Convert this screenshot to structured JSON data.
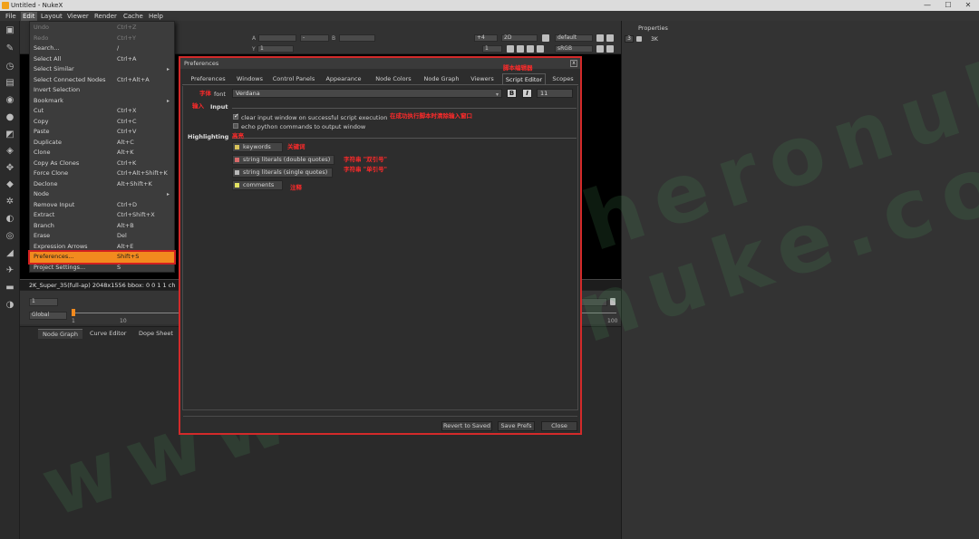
{
  "window": {
    "title": "Untitled - NukeX",
    "minimize": "—",
    "maximize": "☐",
    "close": "✕"
  },
  "menubar": [
    "File",
    "Edit",
    "Layout",
    "Viewer",
    "Render",
    "Cache",
    "Help"
  ],
  "edit_menu": [
    {
      "label": "Undo",
      "shortcut": "Ctrl+Z",
      "disabled": true
    },
    {
      "label": "Redo",
      "shortcut": "Ctrl+Y",
      "disabled": true
    },
    {
      "label": "Search...",
      "shortcut": "/"
    },
    {
      "label": "Select All",
      "shortcut": "Ctrl+A"
    },
    {
      "label": "Select Similar",
      "submenu": true
    },
    {
      "label": "Select Connected Nodes",
      "shortcut": "Ctrl+Alt+A"
    },
    {
      "label": "Invert Selection",
      "shortcut": ""
    },
    {
      "label": "Bookmark",
      "submenu": true
    },
    {
      "label": "Cut",
      "shortcut": "Ctrl+X"
    },
    {
      "label": "Copy",
      "shortcut": "Ctrl+C"
    },
    {
      "label": "Paste",
      "shortcut": "Ctrl+V"
    },
    {
      "label": "Duplicate",
      "shortcut": "Alt+C"
    },
    {
      "label": "Clone",
      "shortcut": "Alt+K"
    },
    {
      "label": "Copy As Clones",
      "shortcut": "Ctrl+K"
    },
    {
      "label": "Force Clone",
      "shortcut": "Ctrl+Alt+Shift+K"
    },
    {
      "label": "Declone",
      "shortcut": "Alt+Shift+K"
    },
    {
      "label": "Node",
      "submenu": true
    },
    {
      "label": "Remove Input",
      "shortcut": "Ctrl+D"
    },
    {
      "label": "Extract",
      "shortcut": "Ctrl+Shift+X"
    },
    {
      "label": "Branch",
      "shortcut": "Alt+B"
    },
    {
      "label": "Erase",
      "shortcut": "Del"
    },
    {
      "label": "Expression Arrows",
      "shortcut": "Alt+E"
    },
    {
      "label": "Preferences...",
      "shortcut": "Shift+S",
      "highlight": true
    },
    {
      "label": "Project Settings...",
      "shortcut": "S"
    }
  ],
  "viewer": {
    "channel_a": "A",
    "channel_b": "B",
    "gain": "+4",
    "view_mode": "2D",
    "lut": "default",
    "colorspace": "sRGB",
    "frame_step": "1",
    "y_label": "Y",
    "y_value": "1",
    "status": "2K_Super_35(full-ap) 2048x1556 bbox: 0 0 1 1 ch"
  },
  "timeline": {
    "frame": "1",
    "scope": "Global",
    "ticks": [
      "1",
      "10",
      "100"
    ]
  },
  "bottom_tabs": [
    "Node Graph",
    "Curve Editor",
    "Dope Sheet"
  ],
  "properties": {
    "title": "Properties",
    "count": "3",
    "zoom": "3K"
  },
  "prefs": {
    "title": "Preferences",
    "close": "x",
    "tabs": [
      "Preferences",
      "Windows",
      "Control Panels",
      "Appearance",
      "Node Colors",
      "Node Graph",
      "Viewers",
      "Script Editor",
      "Scopes"
    ],
    "active_tab": "Script Editor",
    "font_label": "font",
    "font_value": "Verdana",
    "font_size": "11",
    "bold_btn": "B",
    "italic_btn": "I",
    "input_label": "Input",
    "clear_input": "clear input window on successful script execution",
    "echo_python": "echo python commands to output window",
    "highlighting_label": "Highlighting",
    "keywords": "keywords",
    "string_double": "string literals (double quotes)",
    "string_single": "string literals (single quotes)",
    "comments": "comments",
    "revert": "Revert to Saved",
    "save": "Save Prefs",
    "close_btn": "Close"
  },
  "annotations": {
    "script_editor": "脚本编辑器",
    "font": "字体",
    "input": "输入",
    "clear_input": "在成功执行脚本时清除输入窗口",
    "highlight": "高亮",
    "keywords": "关键词",
    "double_quotes": "字符串 \"双引号\"",
    "single_quotes": "字符串 \"单引号\"",
    "comments": "注释"
  },
  "watermark": "www.heronuke.com",
  "colors": {
    "highlight_orange": "#f28a1e",
    "annotation_red": "#ff2a2a",
    "keywords_swatch": "#d9c35a",
    "string_double_swatch": "#d86a6a",
    "string_single_swatch": "#b9b9b9",
    "comments_swatch": "#e1e161"
  }
}
